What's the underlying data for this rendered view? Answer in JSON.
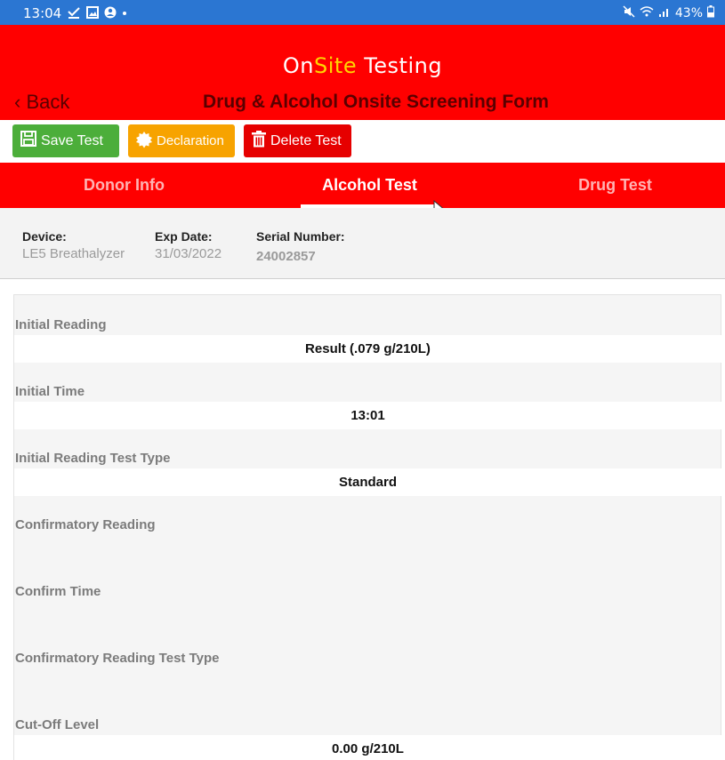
{
  "status_bar": {
    "time": "13:04",
    "battery": "43%"
  },
  "header": {
    "logo_on": "On",
    "logo_site": "Site",
    "logo_testing": " Testing",
    "back_label": "‹ Back",
    "title": "Drug & Alcohol Onsite Screening Form"
  },
  "actions": {
    "save_label": "Save Test",
    "declaration_label": "Declaration",
    "delete_label": "Delete Test"
  },
  "tabs": [
    {
      "label": "Donor Info",
      "active": false
    },
    {
      "label": "Alcohol Test",
      "active": true
    },
    {
      "label": "Drug Test",
      "active": false
    }
  ],
  "device": {
    "device_label": "Device:",
    "device_value": "LE5 Breathalyzer",
    "exp_label": "Exp Date:",
    "exp_value": "31/03/2022",
    "serial_label": "Serial Number:",
    "serial_value": "24002857"
  },
  "fields": {
    "initial_reading_label": "Initial Reading",
    "initial_reading_value": "Result (.079 g/210L)",
    "initial_time_label": "Initial Time",
    "initial_time_value": "13:01",
    "initial_type_label": "Initial Reading Test Type",
    "initial_type_value": "Standard",
    "confirm_reading_label": "Confirmatory Reading",
    "confirm_time_label": "Confirm Time",
    "confirm_type_label": "Confirmatory Reading Test Type",
    "cutoff_label": "Cut-Off Level",
    "cutoff_value": "0.00 g/210L"
  },
  "colors": {
    "header_red": "#ff0000",
    "status_blue": "#2b76d2",
    "save_green": "#4cae3a",
    "declaration_orange": "#f7a300",
    "delete_red": "#e60000"
  }
}
